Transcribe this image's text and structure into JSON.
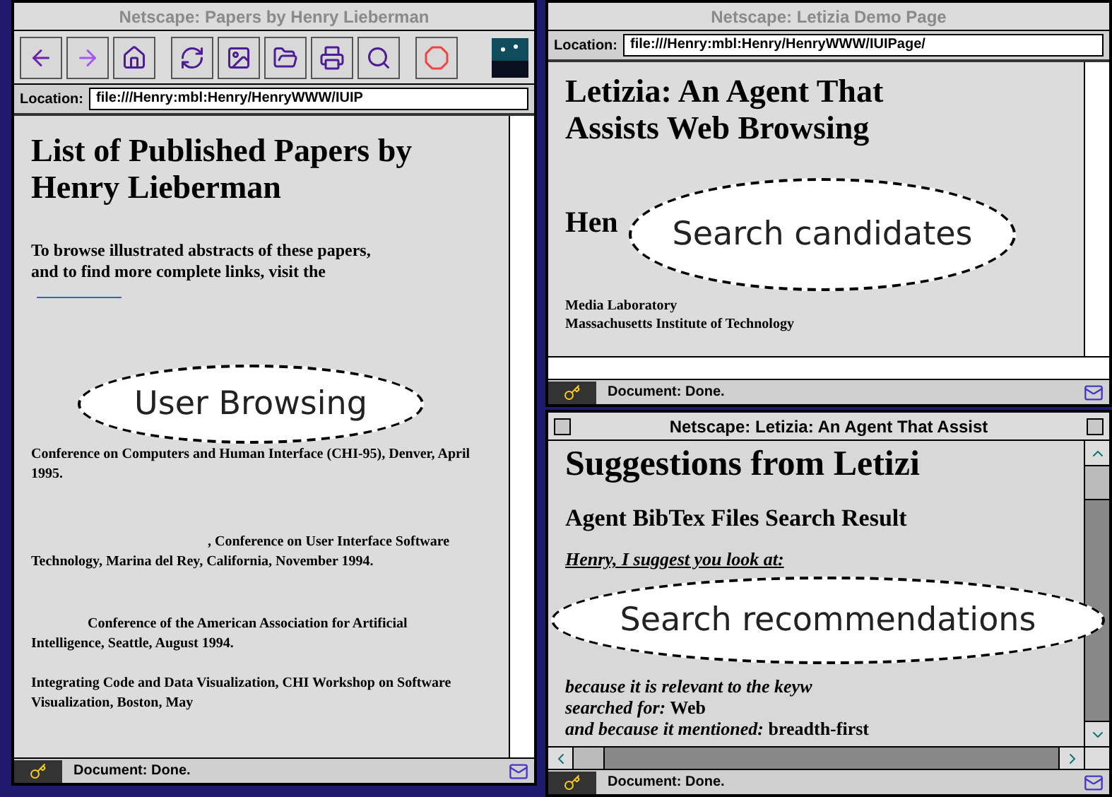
{
  "papers_window": {
    "title": "Netscape: Papers by Henry Lieberman",
    "location_label": "Location:",
    "location": "file:///Henry:mbl:Henry/HenryWWW/IUIP",
    "toolbar": [
      {
        "kind": "back"
      },
      {
        "kind": "forward"
      },
      {
        "kind": "home"
      },
      {
        "kind": "reload"
      },
      {
        "kind": "images"
      },
      {
        "kind": "open"
      },
      {
        "kind": "print"
      },
      {
        "kind": "find"
      },
      {
        "kind": "stop"
      }
    ],
    "content": [
      {
        "kind": "heading",
        "text": "List of Published Papers by Henry Lieberman"
      },
      {
        "kind": "intro",
        "text": "To browse illustrated abstracts of these papers, and to find more complete links, visit the"
      },
      {
        "kind": "entry",
        "text": "Conference on Computers and Human Interface (CHI-95), Denver, April 1995."
      },
      {
        "kind": "entry",
        "text": ", Conference on User Interface Software Technology, Marina del Rey, California, November 1994."
      },
      {
        "kind": "entry",
        "text": "Conference of the American Association for Artificial Intelligence, Seattle, August 1994."
      },
      {
        "kind": "entry",
        "text": "Integrating Code and Data Visualization, CHI Workshop on Software Visualization, Boston, May"
      }
    ],
    "status": "Document: Done."
  },
  "demo_window": {
    "title": "Netscape: Letizia Demo Page",
    "location_label": "Location:",
    "location": "file:///Henry:mbl:Henry/HenryWWW/IUIPage/",
    "content": [
      {
        "kind": "heading",
        "text": "Letizia: An Agent That Assists Web Browsing"
      },
      {
        "kind": "author",
        "text": "Hen"
      },
      {
        "kind": "affiliation",
        "text": "Media Laboratory"
      },
      {
        "kind": "affiliation",
        "text": "Massachusetts Institute of Technology"
      }
    ],
    "status": "Document: Done."
  },
  "suggestions_window": {
    "title": "Netscape: Letizia: An Agent That Assist",
    "content": [
      {
        "kind": "heading",
        "text": "Suggestions from Letizi"
      },
      {
        "kind": "subheading",
        "text": "Agent BibTex Files Search Result"
      },
      {
        "kind": "prompt",
        "text": "Henry, I suggest you look at:"
      },
      {
        "kind": "reason",
        "text": "*because it is relevant to the keyw*"
      },
      {
        "kind": "reason",
        "text": "*searched for:* Web"
      },
      {
        "kind": "reason",
        "text": "*and because it mentioned:* breadth-first"
      }
    ],
    "status": "Document: Done."
  },
  "callouts": [
    {
      "text": "User Browsing"
    },
    {
      "text": "Search candidates"
    },
    {
      "text": "Search recommendations"
    }
  ]
}
